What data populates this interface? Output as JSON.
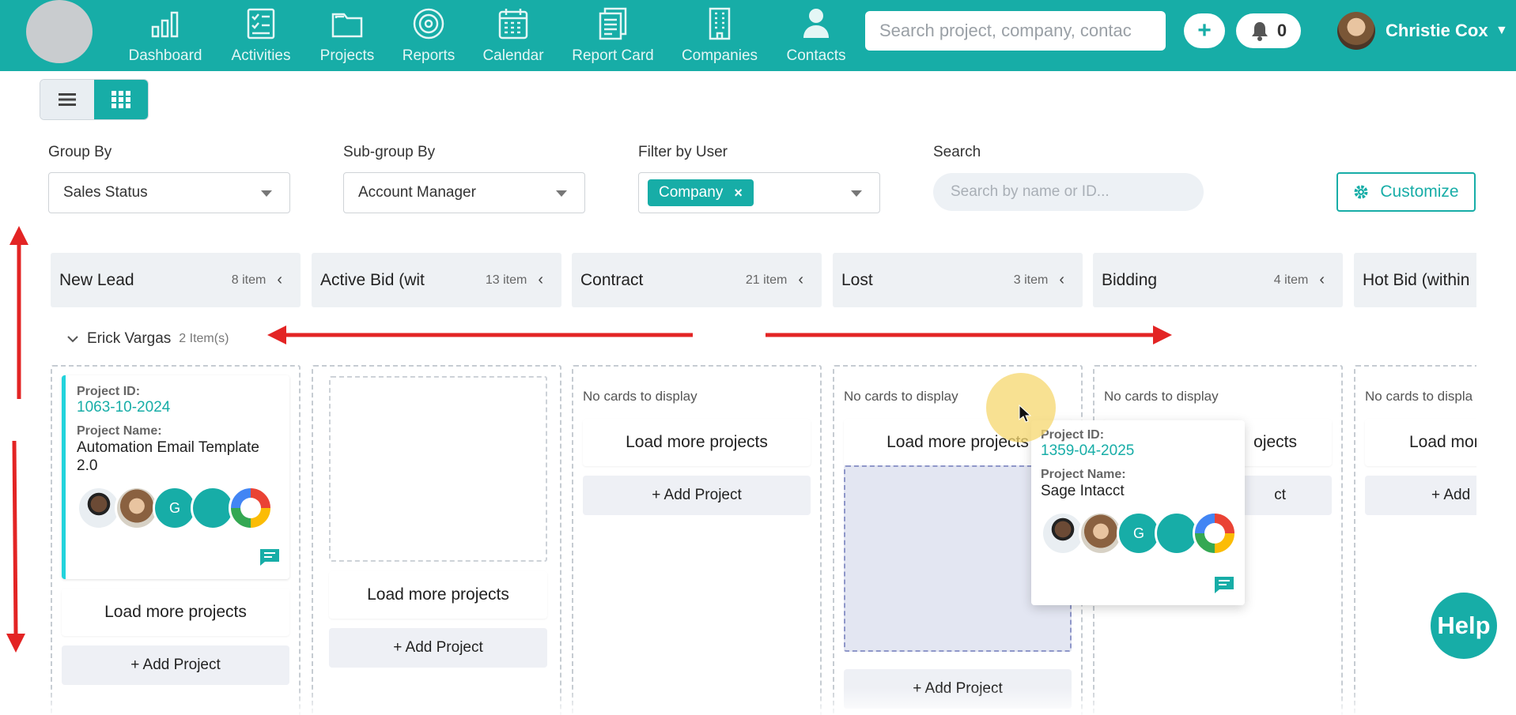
{
  "nav": {
    "items": [
      {
        "label": "Dashboard",
        "icon": "bar-chart-icon"
      },
      {
        "label": "Activities",
        "icon": "checklist-icon"
      },
      {
        "label": "Projects",
        "icon": "folder-icon"
      },
      {
        "label": "Reports",
        "icon": "target-icon"
      },
      {
        "label": "Calendar",
        "icon": "calendar-icon"
      },
      {
        "label": "Report Card",
        "icon": "report-card-icon"
      },
      {
        "label": "Companies",
        "icon": "building-icon"
      },
      {
        "label": "Contacts",
        "icon": "person-icon"
      }
    ],
    "search_placeholder": "Search project, company, contac",
    "add_label": "+",
    "notification_count": "0",
    "user_name": "Christie Cox"
  },
  "filters": {
    "group_by_label": "Group By",
    "group_by_value": "Sales Status",
    "subgroup_label": "Sub-group By",
    "subgroup_value": "Account Manager",
    "filter_user_label": "Filter by User",
    "filter_chip": "Company",
    "chip_remove": "×",
    "search_label": "Search",
    "search_placeholder": "Search by name or ID...",
    "customize_label": "Customize"
  },
  "columns": [
    {
      "title": "New Lead",
      "count": "8 item"
    },
    {
      "title": "Active Bid (wit",
      "count": "13 item"
    },
    {
      "title": "Contract",
      "count": "21 item"
    },
    {
      "title": "Lost",
      "count": "3 item"
    },
    {
      "title": "Bidding",
      "count": "4 item"
    },
    {
      "title": "Hot Bid (within",
      "count": ""
    }
  ],
  "group": {
    "name": "Erick Vargas",
    "count": "2 Item(s)"
  },
  "cards": {
    "card1": {
      "id_label": "Project ID:",
      "id": "1063-10-2024",
      "name_label": "Project Name:",
      "name": "Automation Email Template 2.0",
      "avatar_letter": "G"
    },
    "card2": {
      "id_label": "Project ID:",
      "id": "1359-04-2025",
      "name_label": "Project Name:",
      "name": "Sage Intacct",
      "avatar_letter": "G"
    }
  },
  "texts": {
    "no_cards": "No cards to display",
    "no_cards_cut": "No cards to displa",
    "load_more": "Load more projects",
    "load_more_p1": "Load more projects",
    "load_more_p2": "ojects",
    "load_more_cut": "Load mor",
    "add_project": "+ Add Project",
    "add_project_cut": "+ Add",
    "add_project_tail": "ct",
    "help": "Help"
  },
  "colors": {
    "brand": "#17ada7",
    "annotation_arrow": "#e32424",
    "cursor_highlight": "#f5d76e"
  }
}
